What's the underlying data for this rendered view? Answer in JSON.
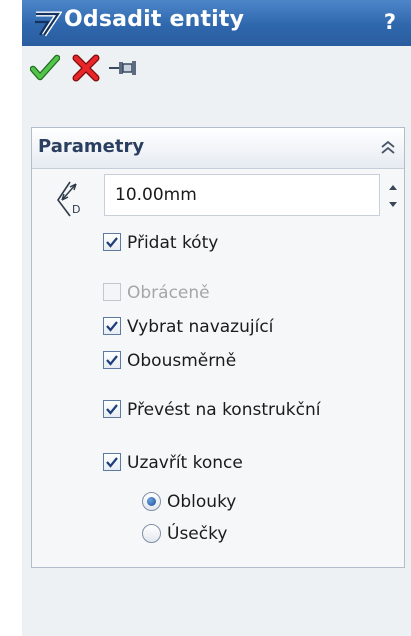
{
  "title": "Odsadit entity",
  "help_label": "?",
  "actions": {
    "ok_icon": "checkmark-icon",
    "cancel_icon": "cancel-x-icon",
    "pin_icon": "pushpin-icon"
  },
  "group": {
    "title": "Parametry",
    "collapse_icon": "double-chevron-up-icon"
  },
  "distance": {
    "icon": "offset-distance-icon",
    "value": "10.00mm"
  },
  "options": {
    "add_dimensions": {
      "label": "Přidat kóty",
      "checked": true,
      "enabled": true
    },
    "reverse": {
      "label": "Obráceně",
      "checked": false,
      "enabled": false
    },
    "select_chain": {
      "label": "Vybrat navazující",
      "checked": true,
      "enabled": true
    },
    "bidirectional": {
      "label": "Obousměrně",
      "checked": true,
      "enabled": true
    },
    "construction": {
      "label": "Převést na konstrukční",
      "checked": true,
      "enabled": true
    },
    "cap_ends": {
      "label": "Uzavřít konce",
      "checked": true,
      "enabled": true
    }
  },
  "cap_type": {
    "selected": "arcs",
    "arcs": {
      "label": "Oblouky"
    },
    "lines": {
      "label": "Úsečky"
    }
  }
}
